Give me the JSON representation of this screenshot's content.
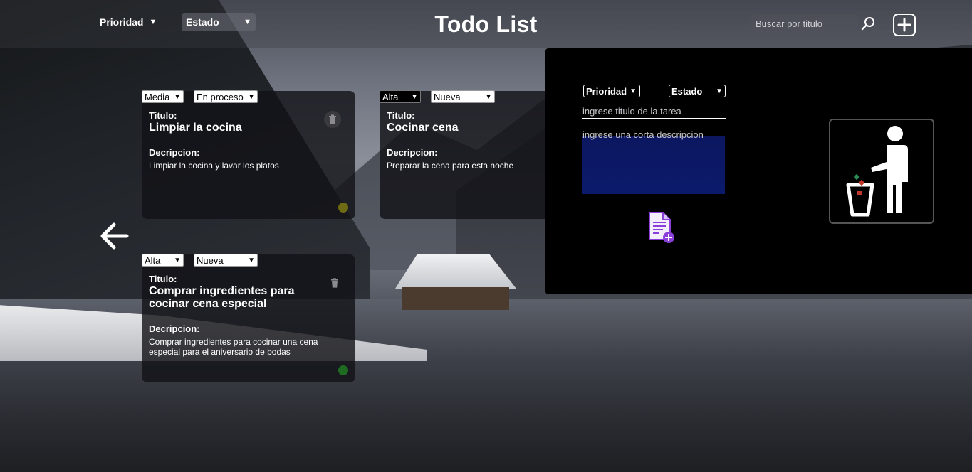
{
  "header": {
    "priority_filter": "Prioridad",
    "status_filter": "Estado",
    "title": "Todo List",
    "search_placeholder": "Buscar por titulo",
    "search_icon": "search-icon",
    "add_icon": "plus-icon"
  },
  "tasks": [
    {
      "priority": "Media",
      "status": "En proceso",
      "title_label": "Titulo:",
      "title": "Limpiar la cocina",
      "desc_label": "Decripcion:",
      "description": "Limpiar la cocina y lavar los platos",
      "status_color": "#6f6b14",
      "has_delete": true
    },
    {
      "priority": "Alta",
      "status": "Nueva",
      "title_label": "Titulo:",
      "title": "Cocinar cena",
      "desc_label": "Decripcion:",
      "description": "Preparar la cena para esta noche",
      "has_delete": false
    },
    {
      "priority": "Alta",
      "status": "Nueva",
      "title_label": "Titulo:",
      "title": "Comprar ingredientes para cocinar cena especial",
      "desc_label": "Decripcion:",
      "description": "Comprar ingredientes para cocinar una cena especial para el aniversario de bodas",
      "status_color": "#1f6b22",
      "has_delete": true
    }
  ],
  "nav": {
    "prev_icon": "arrow-left-icon",
    "next_icon": "arrow-right-icon"
  },
  "new_task_panel": {
    "priority_label": "Prioridad",
    "status_label": "Estado",
    "title_placeholder": "ingrese titulo de la tarea",
    "desc_placeholder": "ingrese una corta descripcion",
    "add_icon": "add-document-icon",
    "drop_zone_icon": "trash-person-icon"
  },
  "colors": {
    "card_bg": "rgba(18,18,22,0.80)",
    "panel_bg": "#000000",
    "desc_field_bg": "#0b1a6b"
  }
}
